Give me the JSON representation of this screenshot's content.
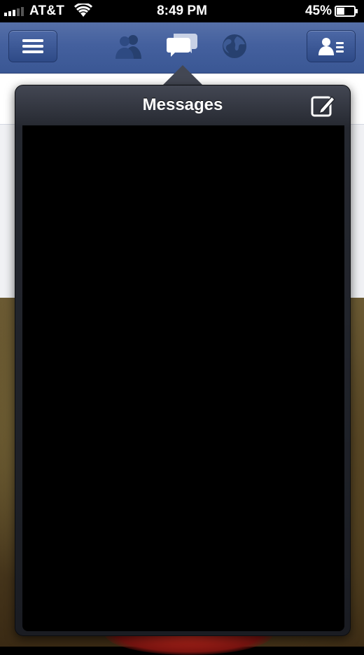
{
  "status_bar": {
    "carrier": "AT&T",
    "time": "8:49 PM",
    "battery": "45%",
    "battery_level": 0.45
  },
  "navbar": {
    "menu_icon": "menu-icon",
    "friend_requests_icon": "friend-requests-icon",
    "messages_icon": "messages-icon",
    "notifications_icon": "globe-icon",
    "contacts_icon": "contacts-icon"
  },
  "messages_popover": {
    "title": "Messages",
    "compose_icon": "compose-icon"
  },
  "colors": {
    "navbar": "#3a5794",
    "popover_header": "#434753",
    "popover_body": "#000000"
  }
}
